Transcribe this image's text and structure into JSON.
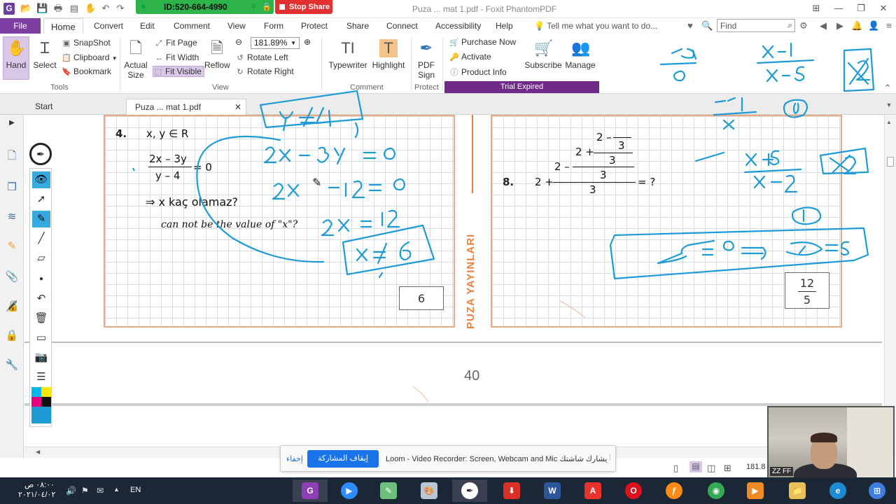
{
  "titlebar": {
    "session_id": "ID:520-664-4990",
    "stop_share": "Stop Share",
    "window_title": "Puza ... mat 1.pdf - Foxit PhantomPDF"
  },
  "menu": {
    "file": "File",
    "tabs": [
      "Home",
      "Convert",
      "Edit",
      "Comment",
      "View",
      "Form",
      "Protect",
      "Share",
      "Connect",
      "Accessibility",
      "Help"
    ],
    "tell_me": "Tell me what you want to do...",
    "find_placeholder": "Find"
  },
  "ribbon": {
    "hand": "Hand",
    "select": "Select",
    "snapshot": "SnapShot",
    "clipboard": "Clipboard",
    "bookmark": "Bookmark",
    "tools_label": "Tools",
    "actual_size_line1": "Actual",
    "actual_size_line2": "Size",
    "fit_page": "Fit Page",
    "fit_width": "Fit Width",
    "fit_visible": "Fit Visible",
    "reflow": "Reflow",
    "zoom_value": "181.89%",
    "rotate_left": "Rotate Left",
    "rotate_right": "Rotate Right",
    "view_label": "View",
    "typewriter": "Typewriter",
    "highlight": "Highlight",
    "comment_label": "Comment",
    "pdf_sign_line1": "PDF",
    "pdf_sign_line2": "Sign",
    "protect_label": "Protect",
    "purchase_now": "Purchase Now",
    "activate": "Activate",
    "product_info": "Product Info",
    "subscribe": "Subscribe",
    "manage": "Manage",
    "trial_expired": "Trial Expired"
  },
  "doc_tabs": {
    "start": "Start",
    "current": "Puza ... mat 1.pdf"
  },
  "document": {
    "q4": {
      "number": "4.",
      "domain": "x, y ∈ R",
      "numerator": "2x – 3y",
      "denominator": "y – 4",
      "equals": "= 0",
      "question": "⇒ x kaç olamaz?",
      "translation": "can not be the value of \"x\"?",
      "answer": "6"
    },
    "q8": {
      "number": "8.",
      "lead": "2 +",
      "mid2": "2 –",
      "mid3": "2 +",
      "top": "2 –",
      "three": "3",
      "result": "= ?",
      "answer_num": "12",
      "answer_den": "5"
    },
    "brand": "PUZA YAYINLARI",
    "page_number": "40"
  },
  "loom": {
    "hide": "إخفاء",
    "stop": "إيقاف المشاركة",
    "message": "Loom - Video Recorder: Screen, Webcam and Mic يشارك شاشتك"
  },
  "status": {
    "zoom": "181.8"
  },
  "webcam": {
    "tag": "ZZ FF"
  },
  "taskbar": {
    "time": "٠٨:٠٠ ص",
    "date": "٢٠٢١/٠٤/٠٢",
    "lang": "EN"
  },
  "colors": {
    "accent": "#7e3fa3",
    "ink": "#1e9bd7",
    "grid_border": "#e8a985",
    "brand": "#f07f3a"
  }
}
